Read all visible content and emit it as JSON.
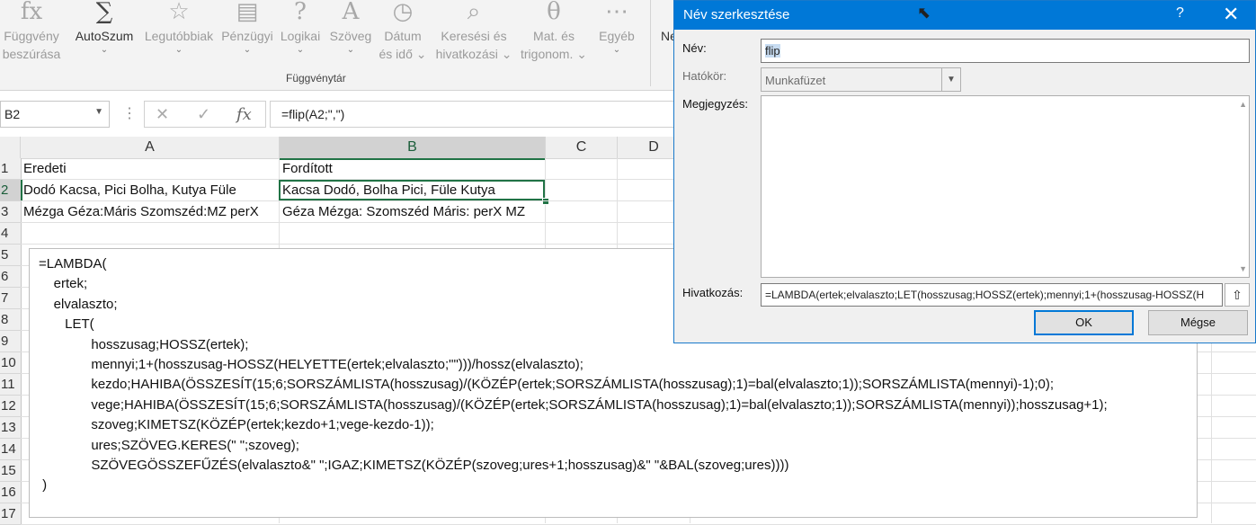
{
  "ribbon": {
    "buttons": [
      {
        "icon": "fx-icon",
        "glyph": "fx",
        "line1": "Függvény",
        "line2": "beszúrása",
        "chev": ""
      },
      {
        "icon": "sigma-icon",
        "glyph": "∑",
        "line1": "AutoSzum",
        "line2": "",
        "chev": "⌄"
      },
      {
        "icon": "star-icon",
        "glyph": "☆",
        "line1": "Legutóbbiak",
        "line2": "",
        "chev": "⌄"
      },
      {
        "icon": "coins-icon",
        "glyph": "▤",
        "line1": "Pénzügyi",
        "line2": "",
        "chev": "⌄"
      },
      {
        "icon": "logic-icon",
        "glyph": "?",
        "line1": "Logikai",
        "line2": "",
        "chev": "⌄"
      },
      {
        "icon": "text-icon",
        "glyph": "A",
        "line1": "Szöveg",
        "line2": "",
        "chev": "⌄"
      },
      {
        "icon": "clock-icon",
        "glyph": "◷",
        "line1": "Dátum",
        "line2": "és idő ⌄",
        "chev": ""
      },
      {
        "icon": "lookup-icon",
        "glyph": "⌕",
        "line1": "Keresési és",
        "line2": "hivatkozási ⌄",
        "chev": ""
      },
      {
        "icon": "math-icon",
        "glyph": "θ",
        "line1": "Mat. és",
        "line2": "trigonom. ⌄",
        "chev": ""
      },
      {
        "icon": "more-icon",
        "glyph": "⋯",
        "line1": "Egyéb",
        "line2": "",
        "chev": "⌄"
      }
    ],
    "partial_label": "Ne",
    "group_label": "Függvénytár"
  },
  "formula_bar": {
    "name_box": "B2",
    "formula": "=flip(A2;\",\")",
    "cancel_glyph": "✕",
    "enter_glyph": "✓",
    "fx_glyph": "fx",
    "dots": "⋮"
  },
  "columns": [
    "A",
    "B",
    "C",
    "D"
  ],
  "rows": [
    "1",
    "2",
    "3",
    "4",
    "5",
    "6",
    "7",
    "8",
    "9",
    "10",
    "11",
    "12",
    "13",
    "14",
    "15",
    "16",
    "17"
  ],
  "cells": {
    "A1": "Eredeti",
    "B1": "Fordított",
    "A2": "Dodó Kacsa, Pici Bolha, Kutya Füle",
    "B2": "Kacsa Dodó, Bolha Pici, Füle Kutya",
    "A3": "Mézga Géza:Máris Szomszéd:MZ perX",
    "B3": "Géza Mézga: Szomszéd Máris: perX MZ"
  },
  "code_lines": [
    "=LAMBDA(",
    "    ertek;",
    "    elvalaszto;",
    "       LET(",
    "              hosszusag;HOSSZ(ertek);",
    "              mennyi;1+(hosszusag-HOSSZ(HELYETTE(ertek;elvalaszto;\"\")))/hossz(elvalaszto);",
    "              kezdo;HAHIBA(ÖSSZESÍT(15;6;SORSZÁMLISTA(hosszusag)/(KÖZÉP(ertek;SORSZÁMLISTA(hosszusag);1)=bal(elvalaszto;1));SORSZÁMLISTA(mennyi)-1);0);",
    "              vege;HAHIBA(ÖSSZESÍT(15;6;SORSZÁMLISTA(hosszusag)/(KÖZÉP(ertek;SORSZÁMLISTA(hosszusag);1)=bal(elvalaszto;1));SORSZÁMLISTA(mennyi));hosszusag+1);",
    "              szoveg;KIMETSZ(KÖZÉP(ertek;kezdo+1;vege-kezdo-1));",
    "              ures;SZÖVEG.KERES(\" \";szoveg);",
    "              SZÖVEGÖSSZEFŰZÉS(elvalaszto&\" \";IGAZ;KIMETSZ(KÖZÉP(szoveg;ures+1;hosszusag)&\" \"&BAL(szoveg;ures))))",
    " )"
  ],
  "dialog": {
    "title": "Név szerkesztése",
    "help": "?",
    "close": "✕",
    "name_label": "Név:",
    "name_value": "flip",
    "scope_label": "Hatókör:",
    "scope_value": "Munkafüzet",
    "comment_label": "Megjegyzés:",
    "refers_label": "Hivatkozás:",
    "refers_value": "=LAMBDA(ertek;elvalaszto;LET(hosszusag;HOSSZ(ertek);mennyi;1+(hosszusag-HOSSZ(H",
    "ok_label": "OK",
    "cancel_label": "Mégse"
  }
}
